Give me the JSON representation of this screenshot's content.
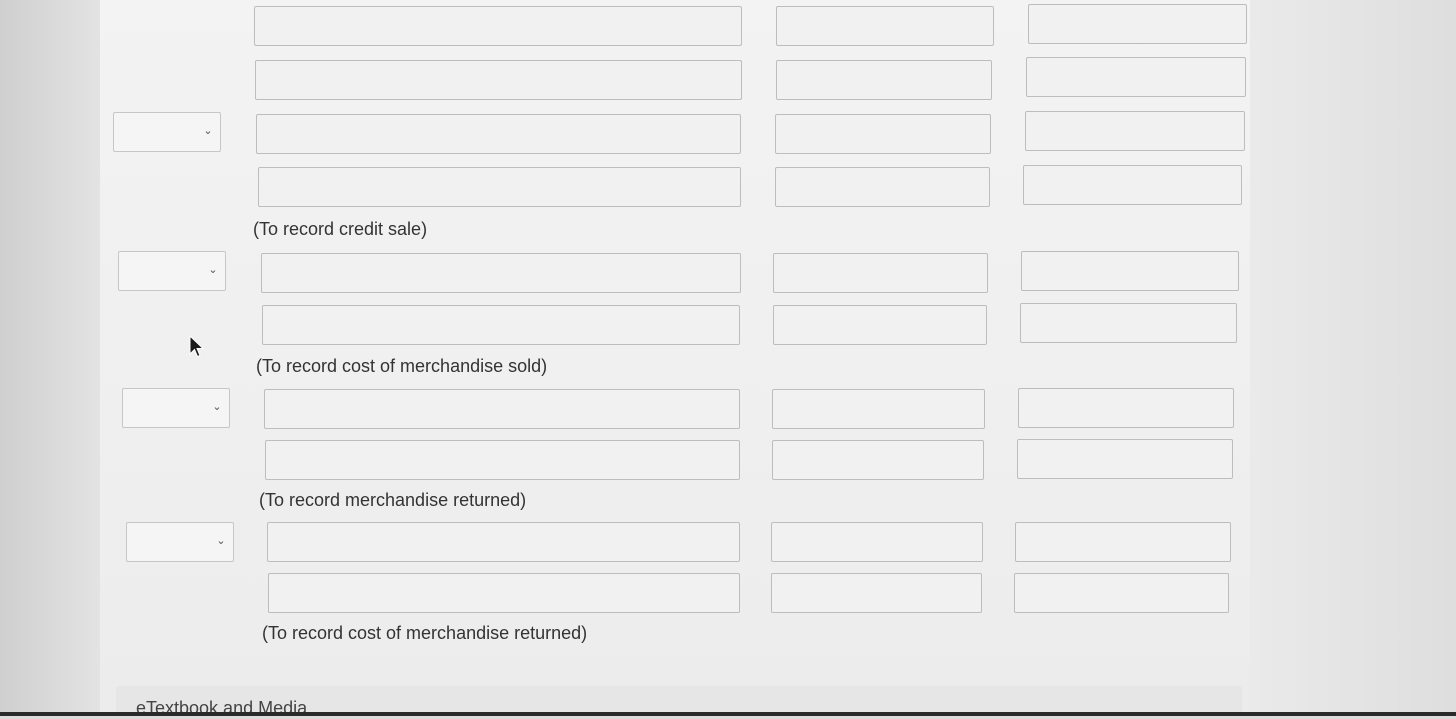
{
  "entries": {
    "credit_sale_note": "(To record credit sale)",
    "cost_sold_note": "(To record cost of merchandise sold)",
    "returned_note": "(To record merchandise returned)",
    "cost_returned_note": "(To record cost of merchandise returned)"
  },
  "footer": {
    "link_label": "eTextbook and Media"
  },
  "icons": {
    "dropdown": "chevron-down-icon",
    "pointer": "mouse-cursor-icon"
  }
}
